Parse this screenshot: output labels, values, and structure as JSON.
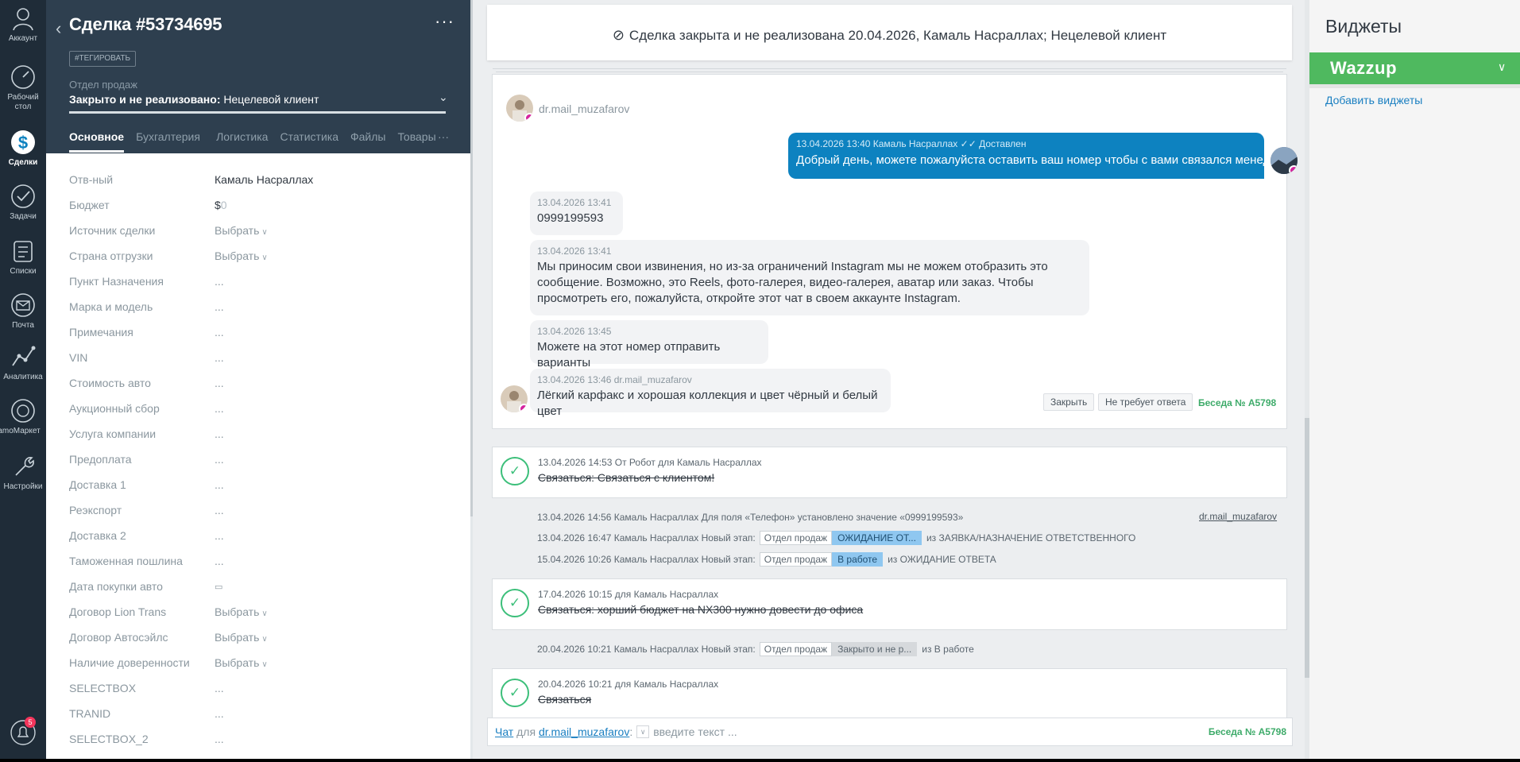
{
  "nav": {
    "items": [
      {
        "label": "Аккаунт",
        "icon": "account-icon"
      },
      {
        "label": "Рабочий стол",
        "icon": "dashboard-icon"
      },
      {
        "label": "Сделки",
        "icon": "deals-icon"
      },
      {
        "label": "Задачи",
        "icon": "tasks-icon"
      },
      {
        "label": "Списки",
        "icon": "lists-icon"
      },
      {
        "label": "Почта",
        "icon": "mail-icon"
      },
      {
        "label": "Аналитика",
        "icon": "analytics-icon"
      },
      {
        "label": "amoМаркет",
        "icon": "market-icon"
      },
      {
        "label": "Настройки",
        "icon": "settings-icon"
      }
    ],
    "notifications_badge": "5"
  },
  "card": {
    "title": "Сделка #53734695",
    "tag_button": "#ТЕГИРОВАТЬ",
    "pipeline": "Отдел продаж",
    "status_prefix": "Закрыто и не реализовано:",
    "status_reason": "Нецелевой клиент",
    "tabs": [
      "Основное",
      "Бухгалтерия",
      "Логистика",
      "Статистика",
      "Файлы",
      "Товары"
    ],
    "tabs_more": "···",
    "fields": [
      {
        "label": "Отв-ный",
        "value": "Камаль Насраллах"
      },
      {
        "label": "Бюджет",
        "value": "$",
        "value2": "0"
      },
      {
        "label": "Источник сделки",
        "value": "Выбрать"
      },
      {
        "label": "Страна отгрузки",
        "value": "Выбрать"
      },
      {
        "label": "Пункт Назначения",
        "value": "..."
      },
      {
        "label": "Марка и модель",
        "value": "..."
      },
      {
        "label": "Примечания",
        "value": "..."
      },
      {
        "label": "VIN",
        "value": "..."
      },
      {
        "label": "Стоимость авто",
        "value": "..."
      },
      {
        "label": "Аукционный сбор",
        "value": "..."
      },
      {
        "label": "Услуга компании",
        "value": "..."
      },
      {
        "label": "Предоплата",
        "value": "..."
      },
      {
        "label": "Доставка 1",
        "value": "..."
      },
      {
        "label": "Реэкспорт",
        "value": "..."
      },
      {
        "label": "Доставка 2",
        "value": "..."
      },
      {
        "label": "Таможенная пошлина",
        "value": "..."
      },
      {
        "label": "Дата покупки авто",
        "value": "▭"
      },
      {
        "label": "Договор Lion Trans",
        "value": "Выбрать"
      },
      {
        "label": "Договор Автосэйлс",
        "value": "Выбрать"
      },
      {
        "label": "Наличие довереннocти",
        "value": "Выбрать"
      },
      {
        "label": "SELECTBOX",
        "value": "..."
      },
      {
        "label": "TRANID",
        "value": "..."
      },
      {
        "label": "SELECTBOX_2",
        "value": "..."
      }
    ]
  },
  "feed": {
    "closed_notice": "Сделка закрыта и не реализована 20.04.2026, Камаль Насраллах; Нецелевой клиент",
    "chat": {
      "contact": "dr.mail_muzafarov",
      "outgoing": {
        "meta": "13.04.2026 13:40 Камаль Насраллах",
        "status": "Доставлен",
        "text": "Добрый день, можете пожалуйста оставить ваш номер чтобы с вами связался менеджер"
      },
      "incoming": [
        {
          "meta": "13.04.2026 13:41",
          "text": "0999199593"
        },
        {
          "meta": "13.04.2026 13:41",
          "text": "Мы приносим свои извинения, но из-за ограничений Instagram мы не можем отобразить это сообщение. Возможно, это Reels, фото-галерея, видео-галерея, аватар или заказ. Чтобы просмотреть его, пожалуйста, откройте этот чат в своем аккаунте Instagram."
        },
        {
          "meta": "13.04.2026 13:45",
          "text": "Можете на этот номер отправить варианты"
        },
        {
          "meta": "13.04.2026 13:46 dr.mail_muzafarov",
          "text": "Лёгкий карфакс и хорошая коллекция и цвет чёрный и белый цвет"
        }
      ],
      "close_button": "Закрыть",
      "no_reply_button": "Не требует ответа",
      "talk_label": "Беседа № A5798"
    },
    "tasks": [
      {
        "meta": "13.04.2026 14:53  От Робот для Камаль Насраллах",
        "text": "Связаться: Связаться с клиентом!"
      },
      {
        "meta": "17.04.2026 10:15  для Камаль Насраллах",
        "text": "Связаться: хорший бюджет на NX300 нужно довести до офиса"
      },
      {
        "meta": "20.04.2026 10:21  для Камаль Насраллах",
        "text": "Связаться"
      }
    ],
    "events": [
      {
        "text": "13.04.2026 14:56 Камаль Насраллах Для поля «Телефон» установлено значение «0999199593»",
        "link": "dr.mail_muzafarov"
      },
      {
        "text": "13.04.2026 16:47 Камаль Насраллах Новый этап:",
        "pipeline": "Отдел продаж",
        "stage": "ОЖИДАНИЕ ОТ...",
        "from": "из ЗАЯВКА/НАЗНАЧЕНИЕ ОТВЕТСТВЕННОГО",
        "stage_color": "#8fc7f0"
      },
      {
        "text": "15.04.2026 10:26 Камаль Насраллах Новый этап:",
        "pipeline": "Отдел продаж",
        "stage": "В работе",
        "from": "из ОЖИДАНИЕ ОТВЕТА",
        "stage_color": "#8fc7f0"
      },
      {
        "text": "20.04.2026 10:21 Камаль Насраллах Новый этап:",
        "pipeline": "Отдел продаж",
        "stage": "Закрыто и не р...",
        "from": "из В работе",
        "stage_color": "#d6d9dc"
      }
    ],
    "compose": {
      "chat_link": "Чат",
      "for": "для",
      "contact": "dr.mail_muzafarov",
      "colon": ":",
      "placeholder": "введите текст ...",
      "talk_label": "Беседа № A5798"
    }
  },
  "widgets": {
    "title": "Виджеты",
    "wazzup": "Wazzup",
    "add": "Добавить виджеты"
  },
  "colors": {
    "nav_bg": "#1f2c38",
    "card_head_bg": "#2e3f4f",
    "outgoing_bubble": "#0d82c0",
    "wazzup_green": "#4fb95f",
    "task_green": "#3cbf7a"
  }
}
